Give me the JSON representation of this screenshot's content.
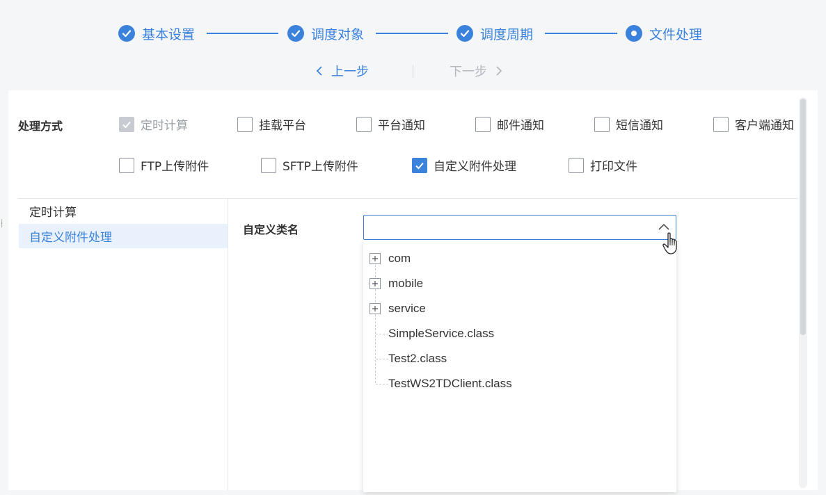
{
  "stepper": {
    "steps": [
      {
        "label": "基本设置",
        "status": "done"
      },
      {
        "label": "调度对象",
        "status": "done"
      },
      {
        "label": "调度周期",
        "status": "done"
      },
      {
        "label": "文件处理",
        "status": "current"
      }
    ]
  },
  "nav": {
    "prev_label": "上一步",
    "next_label": "下一步"
  },
  "processing": {
    "label": "处理方式",
    "options": [
      {
        "label": "定时计算",
        "checked": true,
        "disabled": true
      },
      {
        "label": "挂载平台",
        "checked": false
      },
      {
        "label": "平台通知",
        "checked": false
      },
      {
        "label": "邮件通知",
        "checked": false
      },
      {
        "label": "短信通知",
        "checked": false
      },
      {
        "label": "客户端通知",
        "checked": false
      },
      {
        "label": "FTP上传附件",
        "checked": false
      },
      {
        "label": "SFTP上传附件",
        "checked": false
      },
      {
        "label": "自定义附件处理",
        "checked": true
      },
      {
        "label": "打印文件",
        "checked": false
      }
    ]
  },
  "sidebar": {
    "items": [
      {
        "label": "定时计算",
        "active": false
      },
      {
        "label": "自定义附件处理",
        "active": true
      }
    ]
  },
  "custom_class": {
    "label": "自定义类名",
    "value": "",
    "tree": [
      {
        "label": "com",
        "expandable": true
      },
      {
        "label": "mobile",
        "expandable": true
      },
      {
        "label": "service",
        "expandable": true
      },
      {
        "label": "SimpleService.class",
        "expandable": false
      },
      {
        "label": "Test2.class",
        "expandable": false
      },
      {
        "label": "TestWS2TDClient.class",
        "expandable": false
      }
    ]
  },
  "colors": {
    "accent": "#3b82dc",
    "disabled": "#c8ccd2"
  }
}
